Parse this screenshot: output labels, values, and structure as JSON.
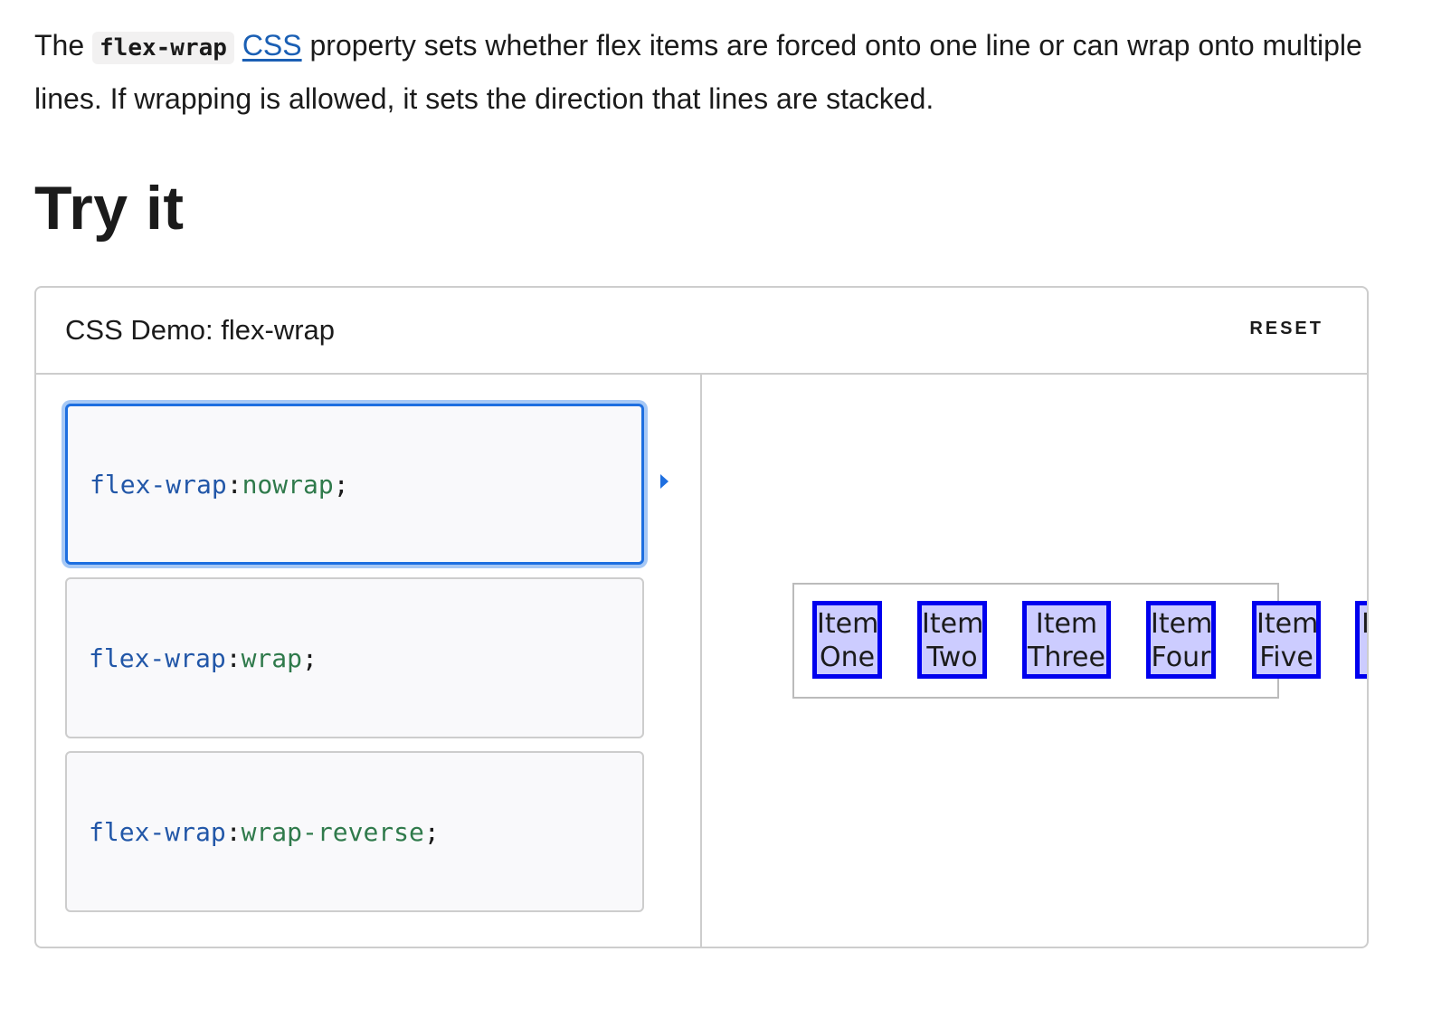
{
  "intro": {
    "prefix": "The ",
    "code": "flex-wrap",
    "link": "CSS",
    "rest": " property sets whether flex items are forced onto one line or can wrap onto multiple lines. If wrapping is allowed, it sets the direction that lines are stacked."
  },
  "heading": "Try it",
  "demo": {
    "title": "CSS Demo: flex-wrap",
    "reset_label": "RESET",
    "choices": [
      {
        "prop": "flex-wrap",
        "sep": ": ",
        "value": "nowrap",
        "end": ";",
        "selected": true
      },
      {
        "prop": "flex-wrap",
        "sep": ": ",
        "value": "wrap",
        "end": ";",
        "selected": false
      },
      {
        "prop": "flex-wrap",
        "sep": ": ",
        "value": "wrap-reverse",
        "end": ";",
        "selected": false
      }
    ],
    "items": [
      {
        "line1": "Item",
        "line2": "One"
      },
      {
        "line1": "Item",
        "line2": "Two"
      },
      {
        "line1": "Item",
        "line2": "Three"
      },
      {
        "line1": "Item",
        "line2": "Four"
      },
      {
        "line1": "Item",
        "line2": "Five"
      },
      {
        "line1": "I",
        "line2": ""
      }
    ],
    "colors": {
      "accent": "#1e6fe0",
      "item_bg": "#ccccff",
      "item_border": "#0000ee",
      "link": "#1a5fb4"
    },
    "icons": {
      "selected_indicator": "caret-right-icon"
    }
  }
}
